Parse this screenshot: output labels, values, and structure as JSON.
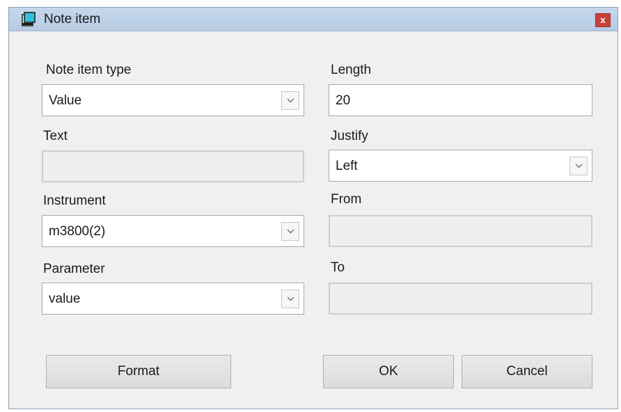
{
  "window": {
    "title": "Note item",
    "close_label": "x"
  },
  "form": {
    "note_item_type": {
      "label": "Note item type",
      "value": "Value"
    },
    "text": {
      "label": "Text",
      "value": ""
    },
    "instrument": {
      "label": "Instrument",
      "value": "m3800(2)"
    },
    "parameter": {
      "label": "Parameter",
      "value": "value"
    },
    "length": {
      "label": "Length",
      "value": "20"
    },
    "justify": {
      "label": "Justify",
      "value": "Left"
    },
    "from": {
      "label": "From",
      "value": ""
    },
    "to": {
      "label": "To",
      "value": ""
    }
  },
  "buttons": {
    "format": "Format",
    "ok": "OK",
    "cancel": "Cancel"
  },
  "colors": {
    "titlebar": "#b6cbe3",
    "close": "#c9403a",
    "dialog_bg": "#f0f0f0"
  },
  "icons": {
    "title": "notepad-icon",
    "dropdown": "chevron-down-icon"
  }
}
